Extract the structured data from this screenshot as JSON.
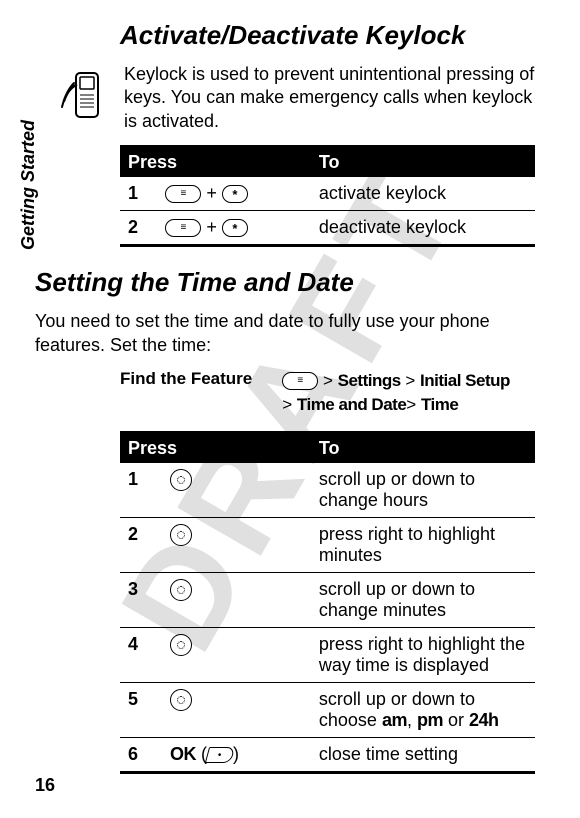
{
  "watermark": "DRAFT",
  "side_label": "Getting Started",
  "section1": {
    "title": "Activate/Deactivate Keylock",
    "intro": "Keylock is used to prevent unintentional pressing of keys. You can make emergency calls when keylock is activated.",
    "table": {
      "headers": {
        "press": "Press",
        "to": "To"
      },
      "rows": [
        {
          "num": "1",
          "press_combo": " + ",
          "to": "activate keylock"
        },
        {
          "num": "2",
          "press_combo": " + ",
          "to": "deactivate keylock"
        }
      ]
    }
  },
  "section2": {
    "title": "Setting the Time and Date",
    "intro": "You need to set the time and date to fully use your phone features. Set the time:",
    "feature": {
      "label": "Find the Feature",
      "path_line1_prefix": " > ",
      "path_settings": "Settings",
      "path_sep": " > ",
      "path_initial": "Initial Setup",
      "path_line2_prefix": " > ",
      "path_timedate": "Time and Date",
      "path_sep2": "> ",
      "path_time": "Time"
    },
    "table": {
      "headers": {
        "press": "Press",
        "to": "To"
      },
      "rows": [
        {
          "num": "1",
          "to": "scroll up or down to change hours"
        },
        {
          "num": "2",
          "to": "press right to highlight minutes"
        },
        {
          "num": "3",
          "to": "scroll up or down to change minutes"
        },
        {
          "num": "4",
          "to": "press right to highlight the way time is displayed"
        },
        {
          "num": "5",
          "to_prefix": "scroll up or down to choose ",
          "to_opts": [
            "am",
            "pm",
            "24h"
          ],
          "to_joins": [
            ", ",
            " or "
          ]
        },
        {
          "num": "6",
          "press_label": "OK",
          "to": "close time setting"
        }
      ]
    }
  },
  "page_number": "16"
}
